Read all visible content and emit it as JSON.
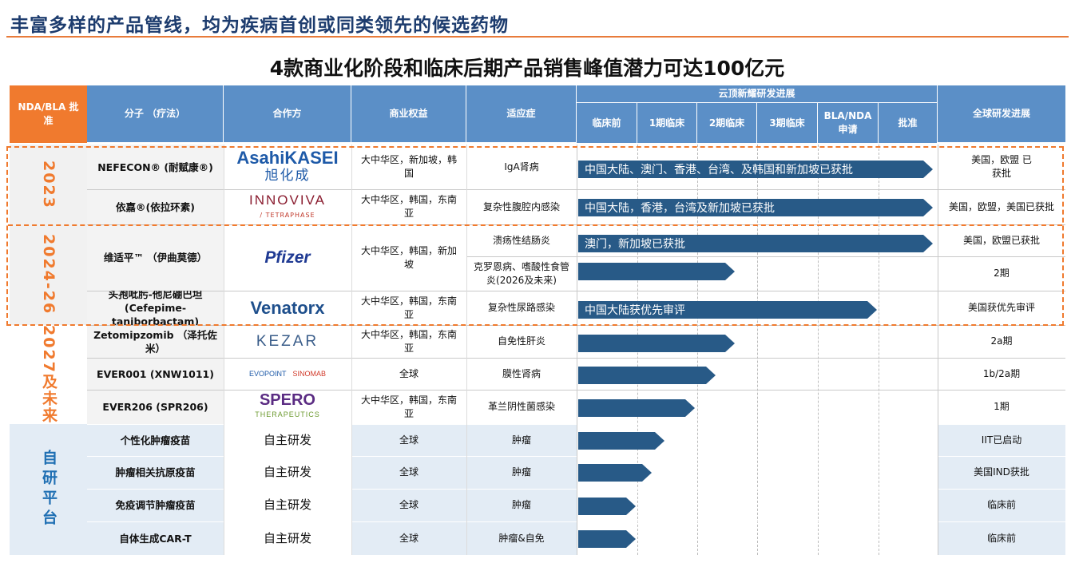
{
  "page": {
    "title": "丰富多样的产品管线，均为疾病首创或同类领先的候选药物",
    "subtitle": "4款商业化阶段和临床后期产品销售峰值潜力可达100亿元"
  },
  "colors": {
    "accent_orange": "#f07a2e",
    "header_blue": "#5b8fc7",
    "bar_navy": "#285a87",
    "title_navy": "#1d3c6e"
  },
  "header": {
    "nda": "NDA/BLA 批准",
    "molecule": "分子 （疗法）",
    "partner": "合作方",
    "rights": "商业权益",
    "indication": "适应症",
    "progress_group": "云顶新耀研发进展",
    "stages": [
      "临床前",
      "1期临床",
      "2期临床",
      "3期临床",
      "BLA/NDA 申请",
      "批准"
    ],
    "global": "全球研发进展"
  },
  "groups": {
    "g2023": "2023",
    "g2024": "2024-26",
    "g2027": "2027及未来",
    "platform": "自研平台"
  },
  "logos": {
    "asahi_en": "AsahiKASEI",
    "asahi_cn": "旭化成",
    "innoviva": "INNOVIVA",
    "tetraphase": "TETRAPHASE",
    "pfizer": "Pfizer",
    "venatorx": "Venatorx",
    "kezar": "KEZAR",
    "evopoint": "EVOPOINT",
    "sinomab": "SINOMAB",
    "spero": "SPERO",
    "spero_sub": "THERAPEUTICS"
  },
  "rows": [
    {
      "molecule": "NEFECON® (耐赋康®)",
      "rights": "大中华区，新加坡，韩国",
      "indication": "IgA肾病",
      "bar": "中国大陆、澳门、香港、台湾、及韩国和新加坡已获批",
      "global": "美国，欧盟 已获批"
    },
    {
      "molecule": "依嘉®(依拉环素)",
      "rights": "大中华区，韩国，东南亚",
      "indication": "复杂性腹腔内感染",
      "bar": "中国大陆，香港，台湾及新加坡已获批",
      "global": "美国，欧盟，美国已获批"
    },
    {
      "molecule": "维适平™ （伊曲莫德）",
      "rights": "大中华区，韩国，新加坡",
      "indication": "溃疡性结肠炎",
      "bar": "澳门，新加坡已获批",
      "global": "美国，欧盟已获批"
    },
    {
      "indication": "克罗恩病、嗜酸性食管炎(2026及未来)",
      "bar": "",
      "global": "2期"
    },
    {
      "molecule": "头孢吡肟-他尼硼巴坦 (Cefepime-taniborbactam)",
      "rights": "大中华区，韩国，东南亚",
      "indication": "复杂性尿路感染",
      "bar": "中国大陆获优先审评",
      "global": "美国获优先审评"
    },
    {
      "molecule": "Zetomipzomib （泽托佐米）",
      "rights": "大中华区，韩国，东南亚",
      "indication": "自免性肝炎",
      "bar": "",
      "global": "2a期"
    },
    {
      "molecule": "EVER001 (XNW1011)",
      "rights": "全球",
      "indication": "膜性肾病",
      "bar": "",
      "global": "1b/2a期"
    },
    {
      "molecule": "EVER206 (SPR206)",
      "rights": "大中华区，韩国，东南亚",
      "indication": "革兰阴性菌感染",
      "bar": "",
      "global": "1期"
    },
    {
      "molecule": "个性化肿瘤疫苗",
      "partner": "自主研发",
      "rights": "全球",
      "indication": "肿瘤",
      "bar": "",
      "global": "IIT已启动"
    },
    {
      "molecule": "肿瘤相关抗原疫苗",
      "partner": "自主研发",
      "rights": "全球",
      "indication": "肿瘤",
      "bar": "",
      "global": "美国IND获批"
    },
    {
      "molecule": "免疫调节肿瘤疫苗",
      "partner": "自主研发",
      "rights": "全球",
      "indication": "肿瘤",
      "bar": "",
      "global": "临床前"
    },
    {
      "molecule": "自体生成CAR-T",
      "partner": "自主研发",
      "rights": "全球",
      "indication": "肿瘤&自免",
      "bar": "",
      "global": "临床前"
    }
  ]
}
